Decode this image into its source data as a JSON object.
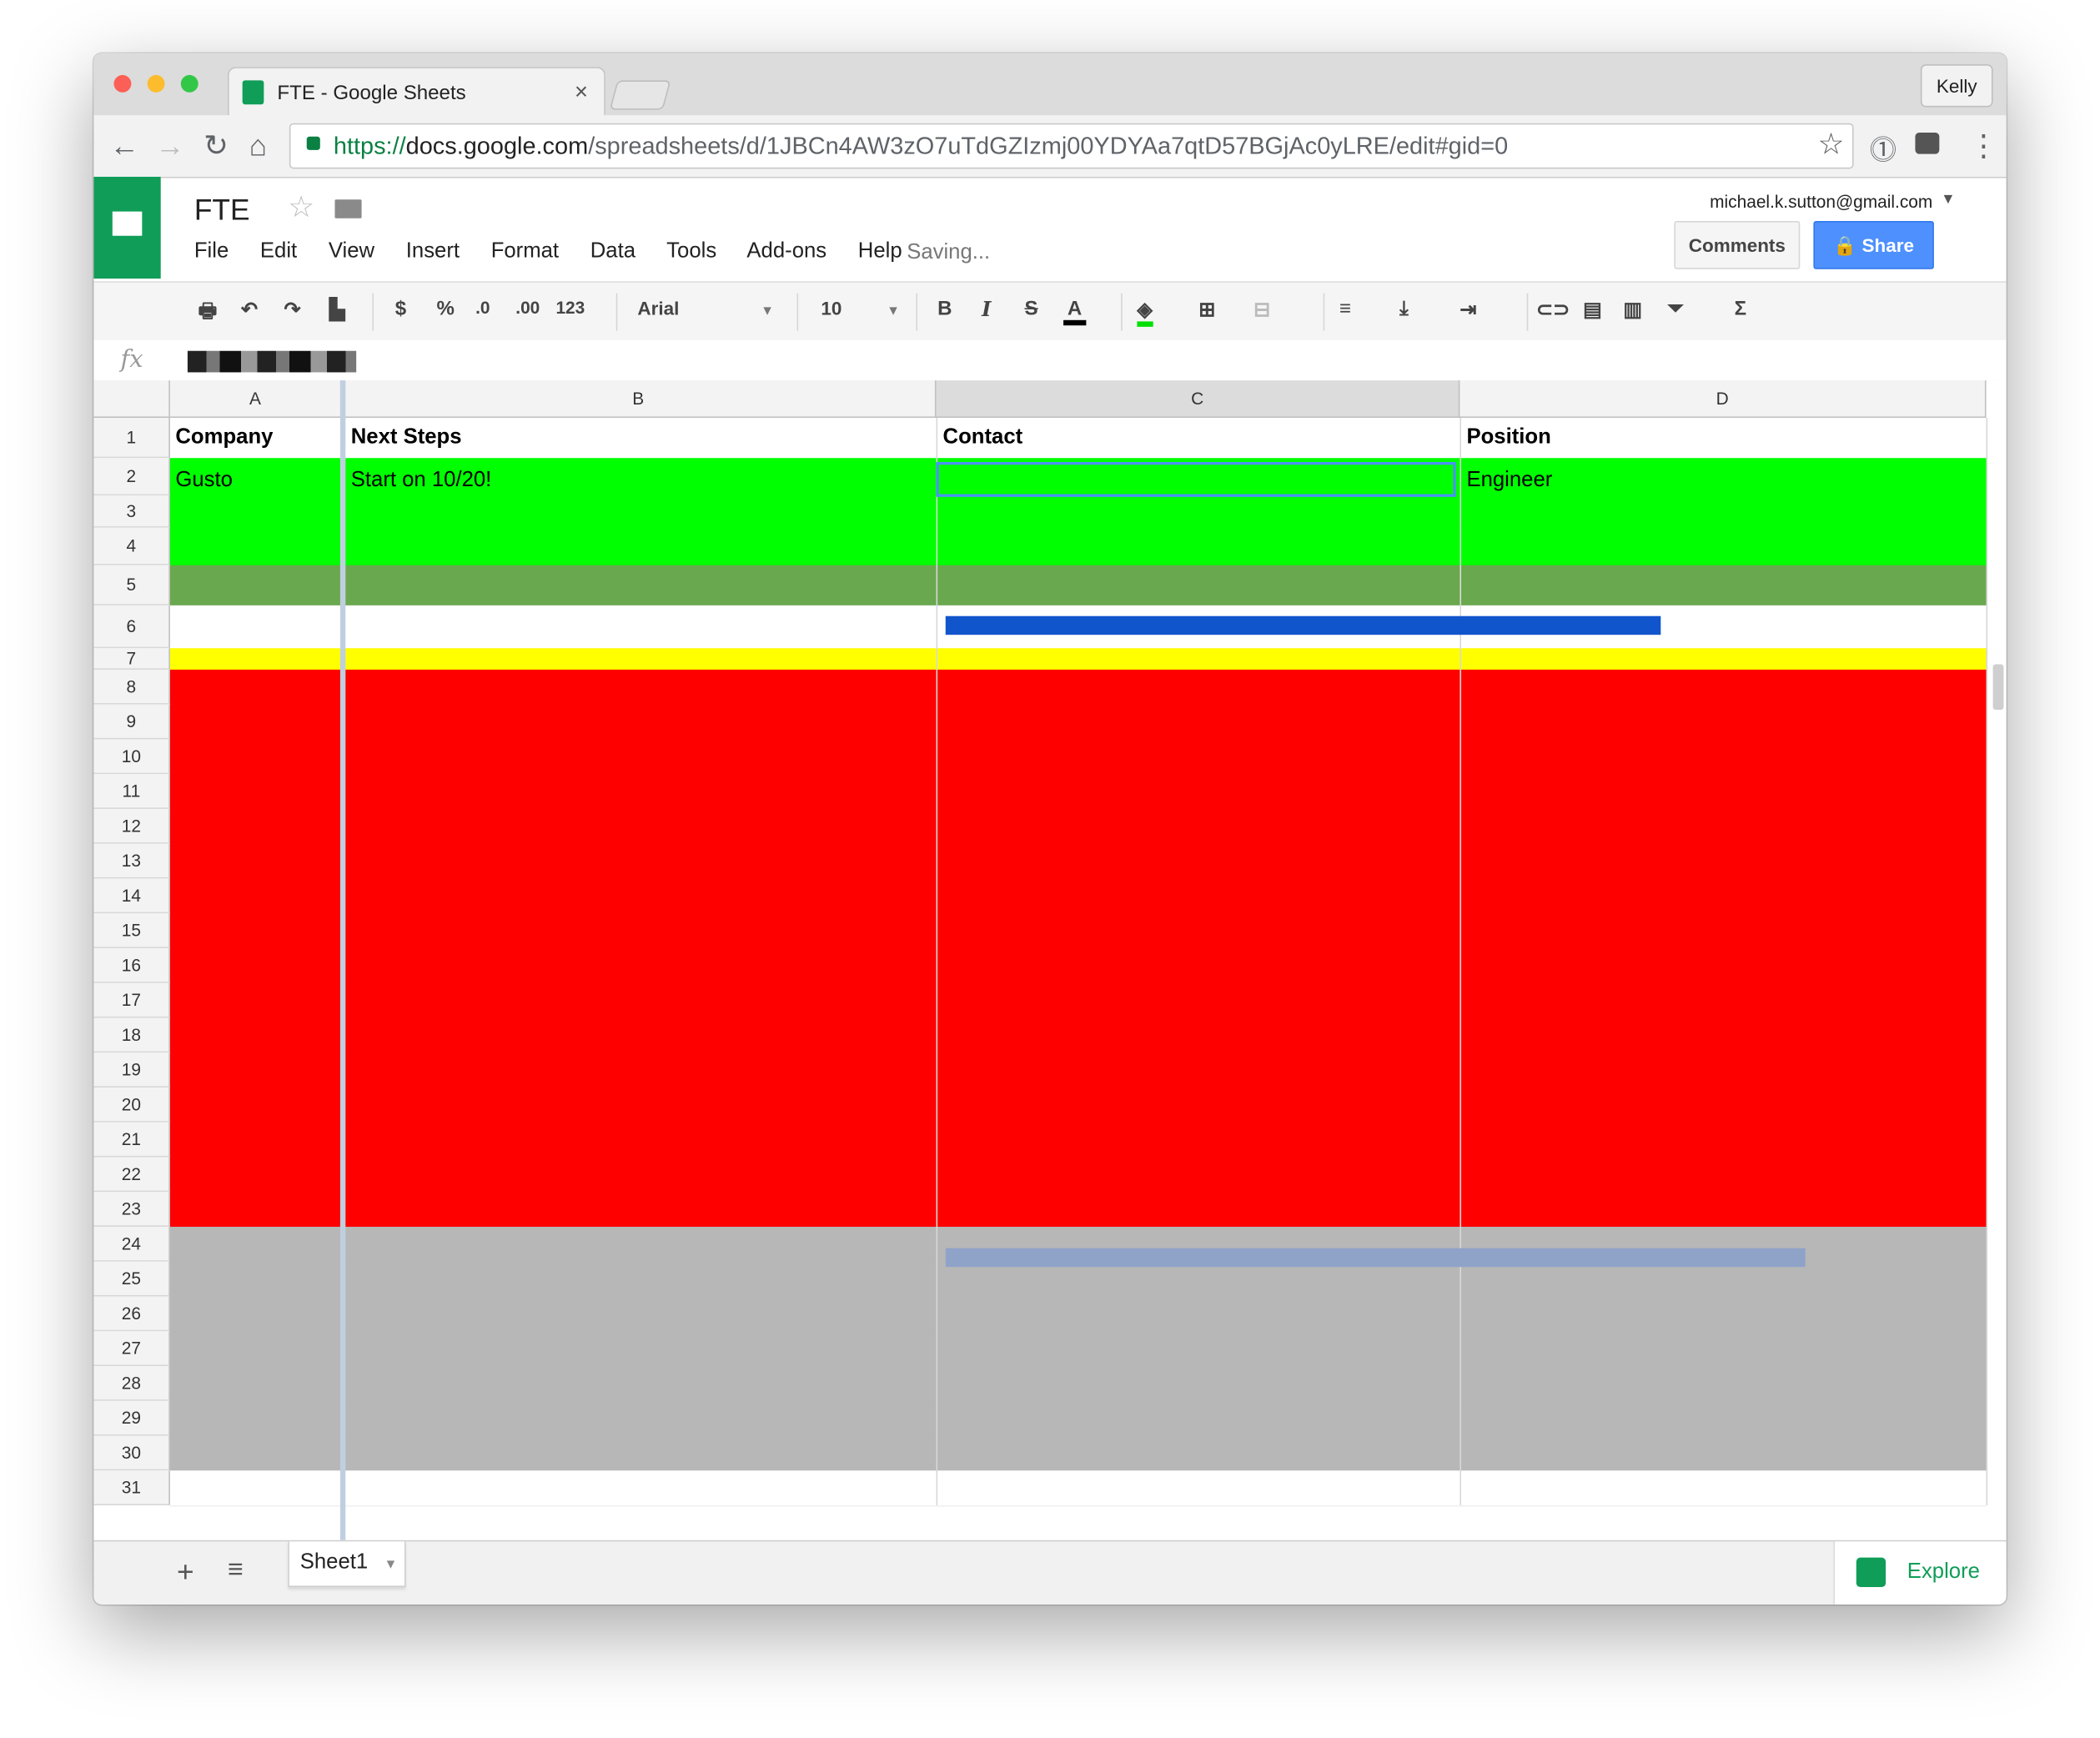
{
  "browser": {
    "tab_title": "FTE - Google Sheets",
    "tab_close": "×",
    "user_button": "Kelly",
    "url_scheme": "https://",
    "url_host": "docs.google.com",
    "url_path": "/spreadsheets/d/1JBCn4AW3zO7uTdGZIzmj00YDYAa7qtD57BGjAc0yLRE/edit#gid=0",
    "traffic_lights": [
      "#fc5f57",
      "#fdbc2e",
      "#33c748"
    ]
  },
  "doc": {
    "title": "FTE",
    "status": "Saving...",
    "account": "michael.k.sutton@gmail.com",
    "comments_label": "Comments",
    "share_label": "Share",
    "menu": [
      "File",
      "Edit",
      "View",
      "Insert",
      "Format",
      "Data",
      "Tools",
      "Add-ons",
      "Help"
    ]
  },
  "format_toolbar": {
    "currency": "$",
    "percent": "%",
    "dec_decrease": ".0",
    "dec_increase": ".00",
    "number_format": "123",
    "font": "Arial",
    "font_size": "10",
    "bold": "B",
    "italic": "I",
    "strike": "S",
    "text_color": "A",
    "sum": "Σ"
  },
  "formula_bar": {
    "fx": "fx"
  },
  "sheet": {
    "columns": [
      "A",
      "B",
      "C",
      "D"
    ],
    "selected_column": "C",
    "row_numbers": [
      "1",
      "2",
      "3",
      "4",
      "5",
      "6",
      "7",
      "8",
      "9",
      "10",
      "11",
      "12",
      "13",
      "14",
      "15",
      "16",
      "17",
      "18",
      "19",
      "20",
      "21",
      "22",
      "23",
      "24",
      "25",
      "26",
      "27",
      "28",
      "29",
      "30",
      "31"
    ],
    "header_row": [
      "Company",
      "Next Steps",
      "Contact",
      "Position"
    ],
    "row2": [
      "Gusto",
      "Start on 10/20!",
      "",
      "Engineer"
    ],
    "row_fill_colors": {
      "green": "#00ff00",
      "olive_green": "#6aa84f",
      "yellow": "#ffff00",
      "red": "#ff0000",
      "gray": "#b7b7b7",
      "blue": "#1155cc"
    }
  },
  "bottom": {
    "sheet_tab": "Sheet1",
    "add_sheet": "+",
    "all_sheets": "≡",
    "explore_label": "Explore"
  }
}
